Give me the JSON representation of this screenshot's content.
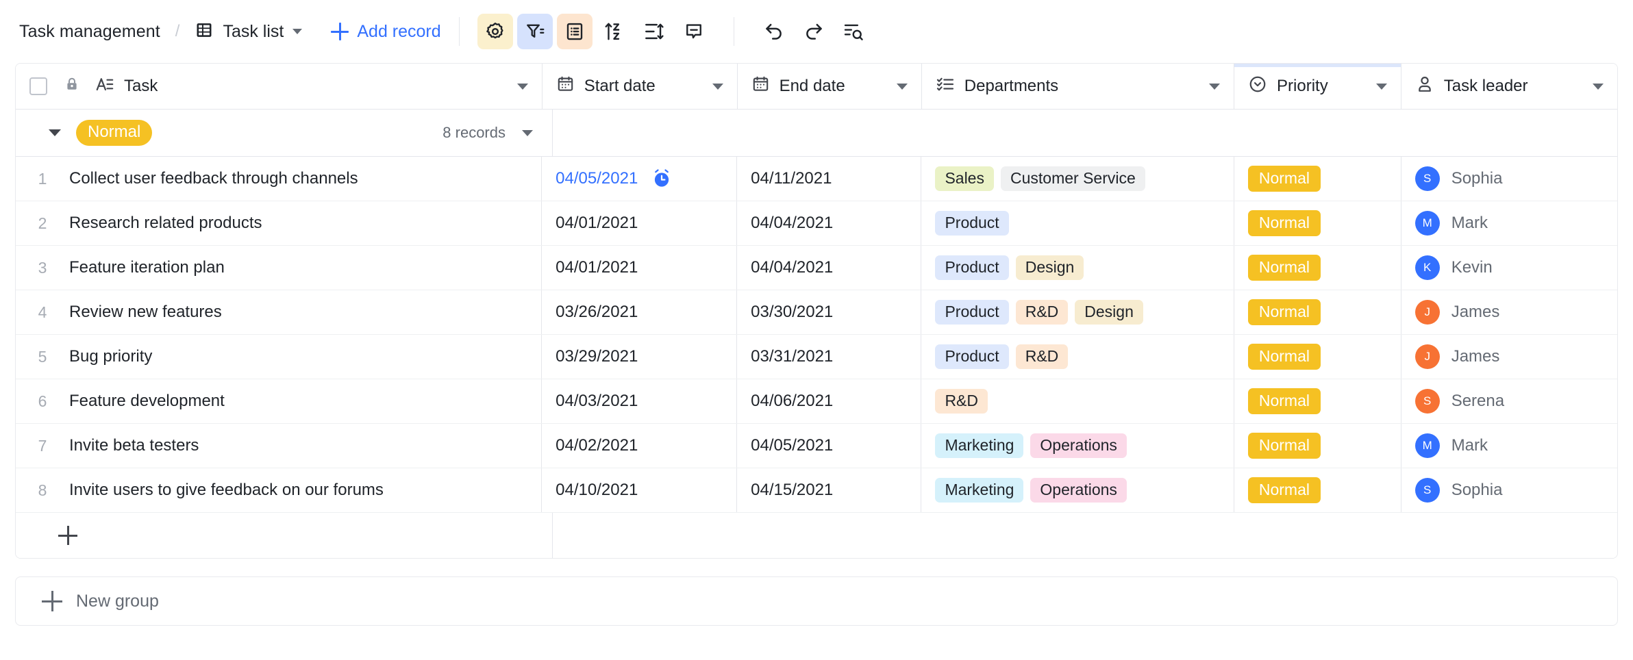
{
  "header": {
    "breadcrumb_root": "Task management",
    "breadcrumb_separator": "/",
    "view_name": "Task list",
    "add_record_label": "Add record",
    "tools": [
      {
        "name": "field-settings-icon",
        "tone": "yellow"
      },
      {
        "name": "filter-icon",
        "tone": "blue"
      },
      {
        "name": "group-icon",
        "tone": "orange"
      },
      {
        "name": "sort-icon",
        "tone": "none"
      },
      {
        "name": "row-height-icon",
        "tone": "none"
      },
      {
        "name": "comment-icon",
        "tone": "none"
      },
      {
        "name": "undo-icon",
        "tone": "none"
      },
      {
        "name": "redo-icon",
        "tone": "none"
      },
      {
        "name": "search-icon",
        "tone": "none"
      }
    ]
  },
  "table": {
    "columns": [
      {
        "key": "task",
        "label": "Task",
        "icon": "text-field-icon",
        "locked": true,
        "accented": false
      },
      {
        "key": "start_date",
        "label": "Start date",
        "icon": "calendar-icon",
        "locked": false,
        "accented": false
      },
      {
        "key": "end_date",
        "label": "End date",
        "icon": "calendar-icon",
        "locked": false,
        "accented": false
      },
      {
        "key": "departments",
        "label": "Departments",
        "icon": "multi-select-icon",
        "locked": false,
        "accented": false
      },
      {
        "key": "priority",
        "label": "Priority",
        "icon": "single-select-icon",
        "locked": false,
        "accented": true
      },
      {
        "key": "task_leader",
        "label": "Task leader",
        "icon": "person-icon",
        "locked": false,
        "accented": false
      }
    ],
    "group": {
      "value": "Normal",
      "records_label": "8 records",
      "color": "#f5c123",
      "expanded": true
    },
    "rows": [
      {
        "num": "1",
        "task": "Collect user feedback through channels",
        "start_date": "04/05/2021",
        "start_date_highlight": true,
        "start_date_reminder": true,
        "end_date": "04/11/2021",
        "departments": [
          {
            "label": "Sales",
            "style": "sales"
          },
          {
            "label": "Customer Service",
            "style": "customer"
          }
        ],
        "priority": "Normal",
        "leader": {
          "name": "Sophia",
          "initial": "S",
          "color": "blue"
        }
      },
      {
        "num": "2",
        "task": "Research related products",
        "start_date": "04/01/2021",
        "start_date_highlight": false,
        "start_date_reminder": false,
        "end_date": "04/04/2021",
        "departments": [
          {
            "label": "Product",
            "style": "product"
          }
        ],
        "priority": "Normal",
        "leader": {
          "name": "Mark",
          "initial": "M",
          "color": "blue"
        }
      },
      {
        "num": "3",
        "task": "Feature iteration plan",
        "start_date": "04/01/2021",
        "start_date_highlight": false,
        "start_date_reminder": false,
        "end_date": "04/04/2021",
        "departments": [
          {
            "label": "Product",
            "style": "product"
          },
          {
            "label": "Design",
            "style": "design"
          }
        ],
        "priority": "Normal",
        "leader": {
          "name": "Kevin",
          "initial": "K",
          "color": "blue"
        }
      },
      {
        "num": "4",
        "task": "Review new features",
        "start_date": "03/26/2021",
        "start_date_highlight": false,
        "start_date_reminder": false,
        "end_date": "03/30/2021",
        "departments": [
          {
            "label": "Product",
            "style": "product"
          },
          {
            "label": "R&D",
            "style": "rd"
          },
          {
            "label": "Design",
            "style": "design"
          }
        ],
        "priority": "Normal",
        "leader": {
          "name": "James",
          "initial": "J",
          "color": "orange"
        }
      },
      {
        "num": "5",
        "task": "Bug priority",
        "start_date": "03/29/2021",
        "start_date_highlight": false,
        "start_date_reminder": false,
        "end_date": "03/31/2021",
        "departments": [
          {
            "label": "Product",
            "style": "product"
          },
          {
            "label": "R&D",
            "style": "rd"
          }
        ],
        "priority": "Normal",
        "leader": {
          "name": "James",
          "initial": "J",
          "color": "orange"
        }
      },
      {
        "num": "6",
        "task": "Feature development",
        "start_date": "04/03/2021",
        "start_date_highlight": false,
        "start_date_reminder": false,
        "end_date": "04/06/2021",
        "departments": [
          {
            "label": "R&D",
            "style": "rd"
          }
        ],
        "priority": "Normal",
        "leader": {
          "name": "Serena",
          "initial": "S",
          "color": "orange"
        }
      },
      {
        "num": "7",
        "task": "Invite beta testers",
        "start_date": "04/02/2021",
        "start_date_highlight": false,
        "start_date_reminder": false,
        "end_date": "04/05/2021",
        "departments": [
          {
            "label": "Marketing",
            "style": "marketing"
          },
          {
            "label": "Operations",
            "style": "operations"
          }
        ],
        "priority": "Normal",
        "leader": {
          "name": "Mark",
          "initial": "M",
          "color": "blue"
        }
      },
      {
        "num": "8",
        "task": "Invite users to give feedback on our forums",
        "start_date": "04/10/2021",
        "start_date_highlight": false,
        "start_date_reminder": false,
        "end_date": "04/15/2021",
        "departments": [
          {
            "label": "Marketing",
            "style": "marketing"
          },
          {
            "label": "Operations",
            "style": "operations"
          }
        ],
        "priority": "Normal",
        "leader": {
          "name": "Sophia",
          "initial": "S",
          "color": "blue"
        }
      }
    ]
  },
  "footer": {
    "new_group_label": "New group"
  },
  "colors": {
    "accent_blue": "#3370ff",
    "badge_yellow": "#f5c123",
    "avatar_blue": "#3370ff",
    "avatar_orange": "#f77234"
  }
}
